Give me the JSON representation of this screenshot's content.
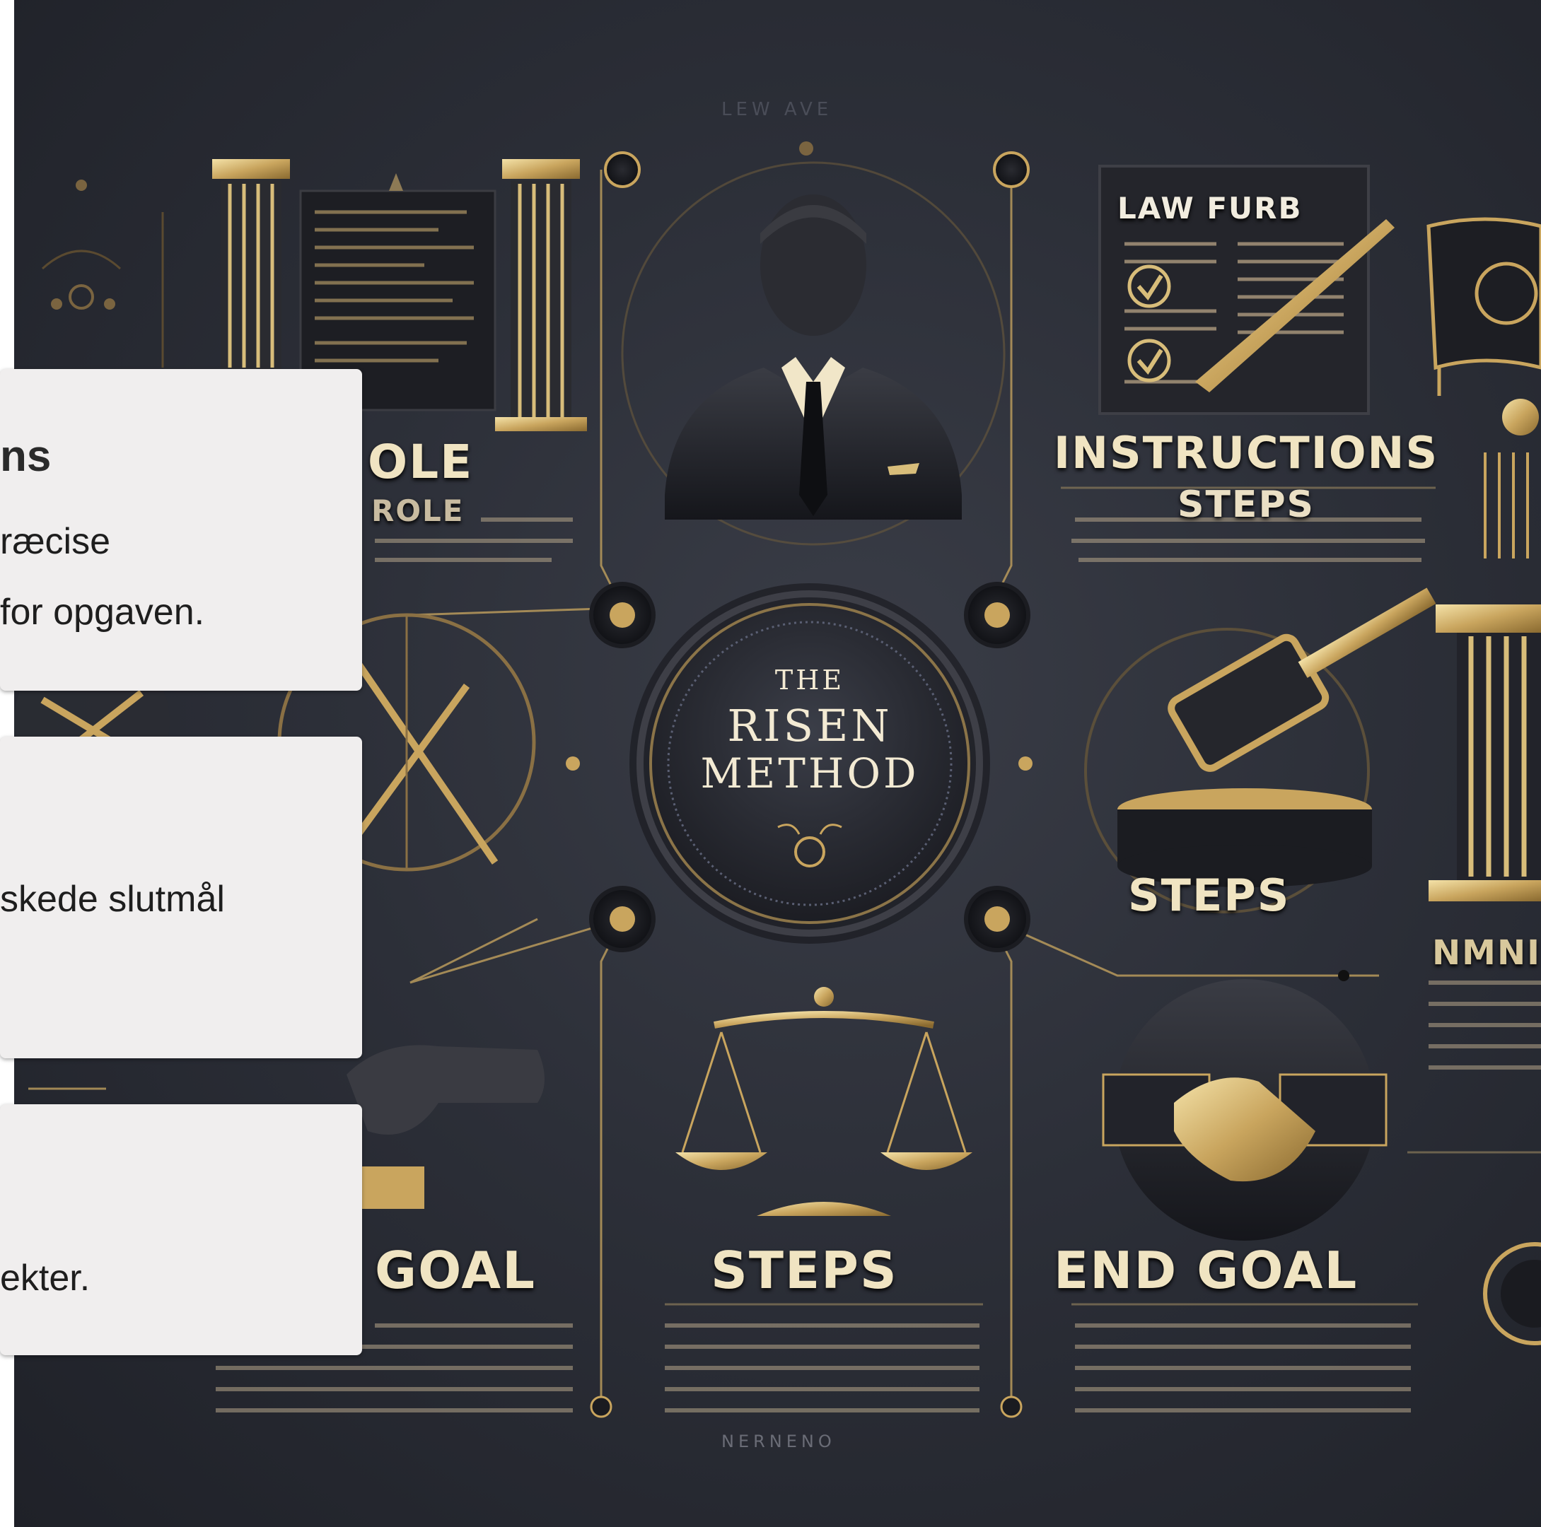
{
  "poster": {
    "faded_header": "LEW  AVE",
    "doc_label": "LAW FURB",
    "heading_role_1": "OLE",
    "heading_role_2": "ROLE",
    "heading_instructions": "INSTRUCTIONS",
    "heading_instructions_sub": "STEPS",
    "center_the": "THE",
    "center_risen": "RISEN",
    "center_method": "METHOD",
    "heading_steps_right": "STEPS",
    "heading_right_partial": "NMNINI",
    "heading_goal": "GOAL",
    "heading_steps_bottom": "STEPS",
    "heading_end_goal": "END GOAL",
    "faded_footer": "NERNENO"
  },
  "cards": [
    {
      "title": "ns",
      "lines": [
        "ræcise",
        "for opgaven."
      ]
    },
    {
      "lines": [
        "skede slutmål"
      ]
    },
    {
      "lines": [
        "ekter."
      ]
    }
  ],
  "colors": {
    "poster_bg": "#2c2f38",
    "gold": "#d8bd7a",
    "card_bg": "#f0eeee"
  }
}
